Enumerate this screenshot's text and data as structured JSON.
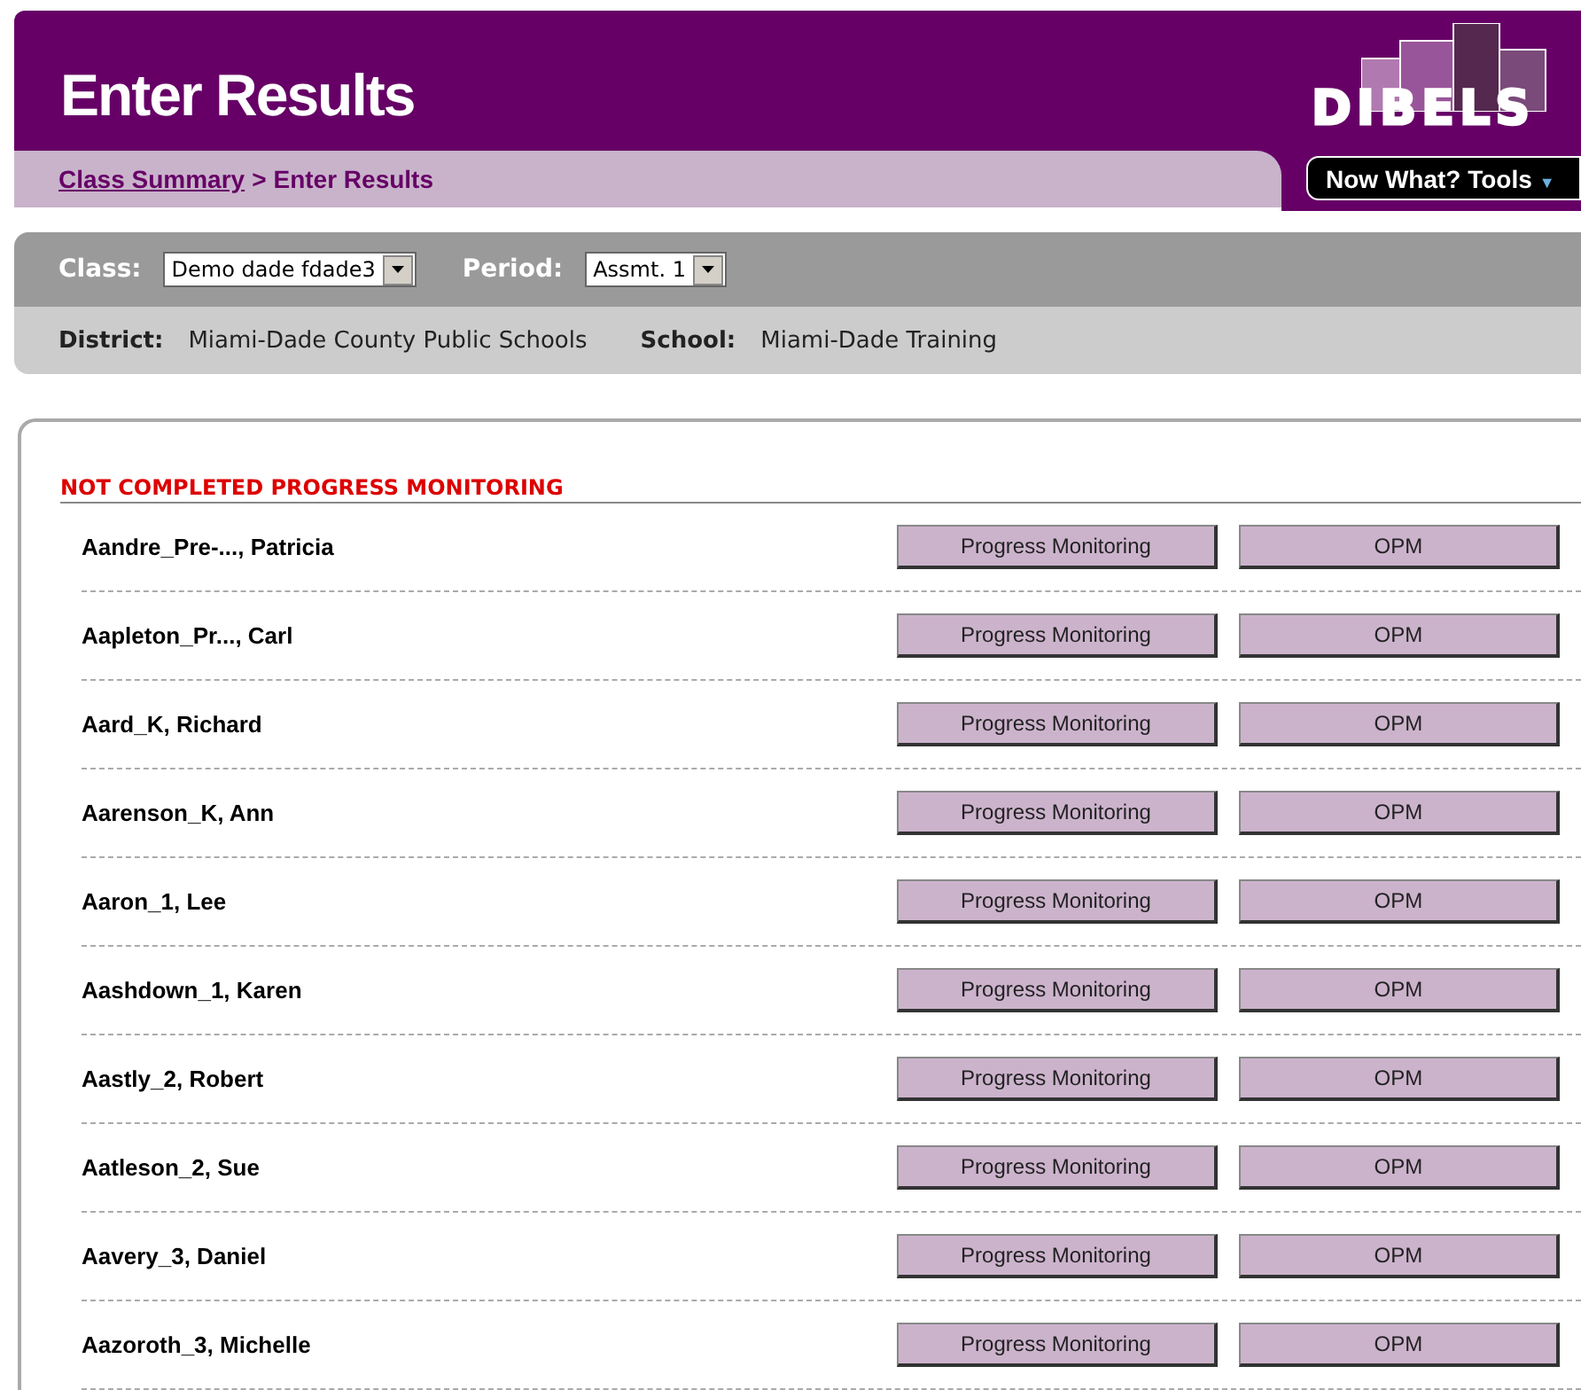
{
  "header": {
    "title": "Enter Results",
    "logo": "DIBELS"
  },
  "breadcrumb": {
    "link": "Class Summary",
    "separator": ">",
    "current": "Enter Results"
  },
  "tools_button": {
    "label": "Now What? Tools",
    "caret": "▼"
  },
  "filters": [
    {
      "label": "Class:",
      "value": "Demo dade fdade3"
    },
    {
      "label": "Period:",
      "value": "Assmt. 1"
    }
  ],
  "info": [
    {
      "label": "District:",
      "value": "Miami-Dade County Public Schools"
    },
    {
      "label": "School:",
      "value": "Miami-Dade Training"
    }
  ],
  "section": {
    "title": "NOT COMPLETED PROGRESS MONITORING"
  },
  "students": [
    {
      "name": "Aandre_Pre-..., Patricia",
      "actions": [
        "Progress Monitoring",
        "OPM"
      ]
    },
    {
      "name": "Aapleton_Pr..., Carl",
      "actions": [
        "Progress Monitoring",
        "OPM"
      ]
    },
    {
      "name": "Aard_K, Richard",
      "actions": [
        "Progress Monitoring",
        "OPM"
      ]
    },
    {
      "name": "Aarenson_K, Ann",
      "actions": [
        "Progress Monitoring",
        "OPM"
      ]
    },
    {
      "name": "Aaron_1, Lee",
      "actions": [
        "Progress Monitoring",
        "OPM"
      ]
    },
    {
      "name": "Aashdown_1, Karen",
      "actions": [
        "Progress Monitoring",
        "OPM"
      ]
    },
    {
      "name": "Aastly_2, Robert",
      "actions": [
        "Progress Monitoring",
        "OPM"
      ]
    },
    {
      "name": "Aatleson_2, Sue",
      "actions": [
        "Progress Monitoring",
        "OPM"
      ]
    },
    {
      "name": "Aavery_3, Daniel",
      "actions": [
        "Progress Monitoring",
        "OPM"
      ]
    },
    {
      "name": "Aazoroth_3, Michelle",
      "actions": [
        "Progress Monitoring",
        "OPM"
      ]
    }
  ]
}
